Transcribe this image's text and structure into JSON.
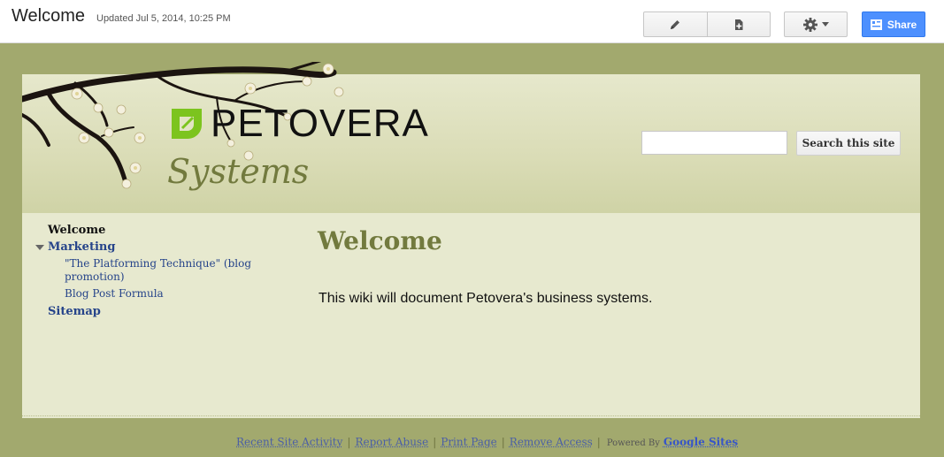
{
  "topbar": {
    "page_title": "Welcome",
    "updated": "Updated Jul 5, 2014, 10:25 PM",
    "share_label": "Share"
  },
  "header": {
    "logo_text": "PETOVERA",
    "site_name": "Systems",
    "search_button": "Search this site"
  },
  "sidebar": {
    "items": [
      {
        "label": "Welcome"
      },
      {
        "label": "Marketing"
      },
      {
        "label": "\"The Platforming Technique\" (blog promotion)"
      },
      {
        "label": "Blog Post Formula"
      },
      {
        "label": "Sitemap"
      }
    ]
  },
  "main": {
    "title": "Welcome",
    "body": "This wiki will document Petovera's business systems."
  },
  "footer": {
    "recent_activity": "Recent Site Activity",
    "report_abuse": "Report Abuse",
    "print_page": "Print Page",
    "remove_access": "Remove Access",
    "powered_by": "Powered By",
    "google_sites": "Google Sites"
  },
  "colors": {
    "background": "#a2a96e",
    "content": "#e7e9cf",
    "accent_olive": "#727a3e",
    "link_blue": "#26448a",
    "share_blue": "#4d90fe",
    "logo_green": "#7cc41e"
  }
}
